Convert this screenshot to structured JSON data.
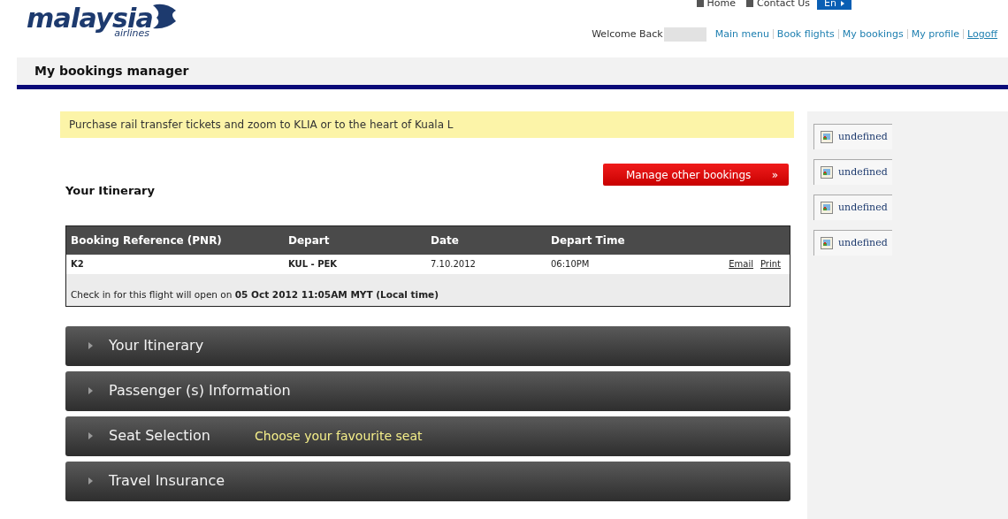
{
  "logo": {
    "name": "malaysia",
    "subtitle": "airlines"
  },
  "top_links": [
    "Home",
    "Contact Us"
  ],
  "language": "En",
  "welcome": "Welcome Back",
  "nav_links": [
    {
      "label": "Main menu",
      "underlined": false
    },
    {
      "label": "Book flights",
      "underlined": false
    },
    {
      "label": "My bookings",
      "underlined": false
    },
    {
      "label": "My profile",
      "underlined": false
    },
    {
      "label": "Logoff",
      "underlined": true
    }
  ],
  "page_title": "My bookings manager",
  "banner": "Purchase rail transfer tickets and zoom to KLIA or to the heart of Kuala L",
  "manage_button": "Manage other bookings",
  "manage_button_icon": "»",
  "itinerary_heading": "Your Itinerary",
  "table": {
    "columns": [
      "Booking Reference (PNR)",
      "Depart",
      "Date",
      "Depart Time"
    ],
    "rows": [
      {
        "pnr": "K2",
        "depart": "KUL - PEK",
        "date": "7.10.2012",
        "time": "06:10PM",
        "actions": [
          "Email",
          "Print"
        ]
      }
    ],
    "note": "Check in for this flight will open on **05 Oct 2012 11:05AM MYT (Local time)**"
  },
  "sections": [
    {
      "title": "Your Itinerary",
      "expanded": false
    },
    {
      "title": "Passenger (s) Information",
      "expanded": false
    },
    {
      "title": "Seat Selection",
      "expanded": false,
      "hint": "Choose your favourite seat"
    },
    {
      "title": "Travel Insurance",
      "expanded": false
    }
  ],
  "sidebar_items": [
    "undefined",
    "undefined",
    "undefined",
    "undefined"
  ]
}
